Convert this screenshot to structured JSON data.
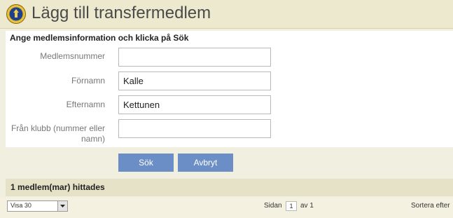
{
  "header": {
    "title": "Lägg till transfermedlem",
    "logo_icon": "lions-club-logo"
  },
  "form": {
    "instruction": "Ange medlemsinformation och klicka på Sök",
    "fields": [
      {
        "label": "Medlemsnummer",
        "value": ""
      },
      {
        "label": "Förnamn",
        "value": "Kalle"
      },
      {
        "label": "Efternamn",
        "value": "Kettunen"
      },
      {
        "label": "Från klubb (nummer eller namn)",
        "value": ""
      }
    ],
    "search_label": "Sök",
    "cancel_label": "Avbryt"
  },
  "results": {
    "summary": "1 medlem(mar) hittades",
    "page_size": "Visa 30",
    "page_label": "Sidan",
    "page_number": "1",
    "page_of": "av 1",
    "sort_label": "Sortera efter"
  },
  "colors": {
    "accent_button": "#6c8ec6",
    "title_bar": "#ece9cf",
    "results_bar": "#e6e2c7"
  }
}
